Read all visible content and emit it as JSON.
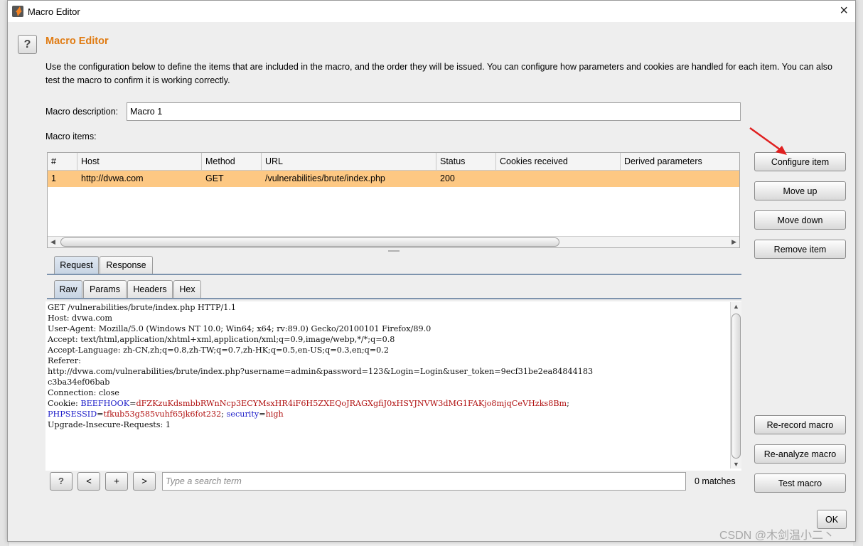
{
  "window": {
    "title": "Macro Editor",
    "close_glyph": "×"
  },
  "help_glyph": "?",
  "heading": "Macro Editor",
  "description": "Use the configuration below to define the items that are included in the macro, and the order they will be issued. You can configure how parameters and cookies are handled for each item. You can also test the macro to confirm it is working correctly.",
  "macro_description": {
    "label": "Macro description:",
    "value": "Macro 1"
  },
  "macro_items_label": "Macro items:",
  "table": {
    "columns": [
      "#",
      "Host",
      "Method",
      "URL",
      "Status",
      "Cookies received",
      "Derived parameters"
    ],
    "rows": [
      {
        "num": "1",
        "host": "http://dvwa.com",
        "method": "GET",
        "url": "/vulnerabilities/brute/index.php",
        "status": "200",
        "cookies": "",
        "derived": ""
      }
    ],
    "selected_row_color": "#fdc883"
  },
  "side_buttons": {
    "configure": "Configure item",
    "move_up": "Move up",
    "move_down": "Move down",
    "remove": "Remove item",
    "rerecord": "Re-record macro",
    "reanalyze": "Re-analyze macro",
    "test": "Test macro"
  },
  "tabs_outer": [
    "Request",
    "Response"
  ],
  "tabs_inner": [
    "Raw",
    "Params",
    "Headers",
    "Hex"
  ],
  "request": {
    "line1": "GET /vulnerabilities/brute/index.php HTTP/1.1",
    "line2": "Host: dvwa.com",
    "line3": "User-Agent: Mozilla/5.0 (Windows NT 10.0; Win64; x64; rv:89.0) Gecko/20100101 Firefox/89.0",
    "line4": "Accept: text/html,application/xhtml+xml,application/xml;q=0.9,image/webp,*/*;q=0.8",
    "line5": "Accept-Language: zh-CN,zh;q=0.8,zh-TW;q=0.7,zh-HK;q=0.5,en-US;q=0.3,en;q=0.2",
    "line6": "Referer:",
    "line7": "http://dvwa.com/vulnerabilities/brute/index.php?username=admin&password=123&Login=Login&user_token=9ecf31be2ea84844183",
    "line8": "c3ba34ef06bab",
    "line9": "Connection: close",
    "cookie_label": "Cookie: ",
    "cookie1_name": "BEEFHOOK",
    "cookie1_value": "dFZKzuKdsmbbRWnNcp3ECYMsxHR4iF6H5ZXEQoJRAGXgfiJ0xHSYJNVW3dMG1FAKjo8mjqCeVHzks8Bm",
    "cookie2_name": "PHPSESSID",
    "cookie2_value": "tfkub53g585vuhf65jk6fot232",
    "cookie3_name": "security",
    "cookie3_value": "high",
    "line12": "Upgrade-Insecure-Requests: 1"
  },
  "search": {
    "help": "?",
    "prev": "<",
    "add": "+",
    "next": ">",
    "placeholder": "Type a search term",
    "matches": "0 matches"
  },
  "ok_label": "OK",
  "watermark": "CSDN @木剑温小二丶",
  "annotation_arrow_color": "#e02020"
}
